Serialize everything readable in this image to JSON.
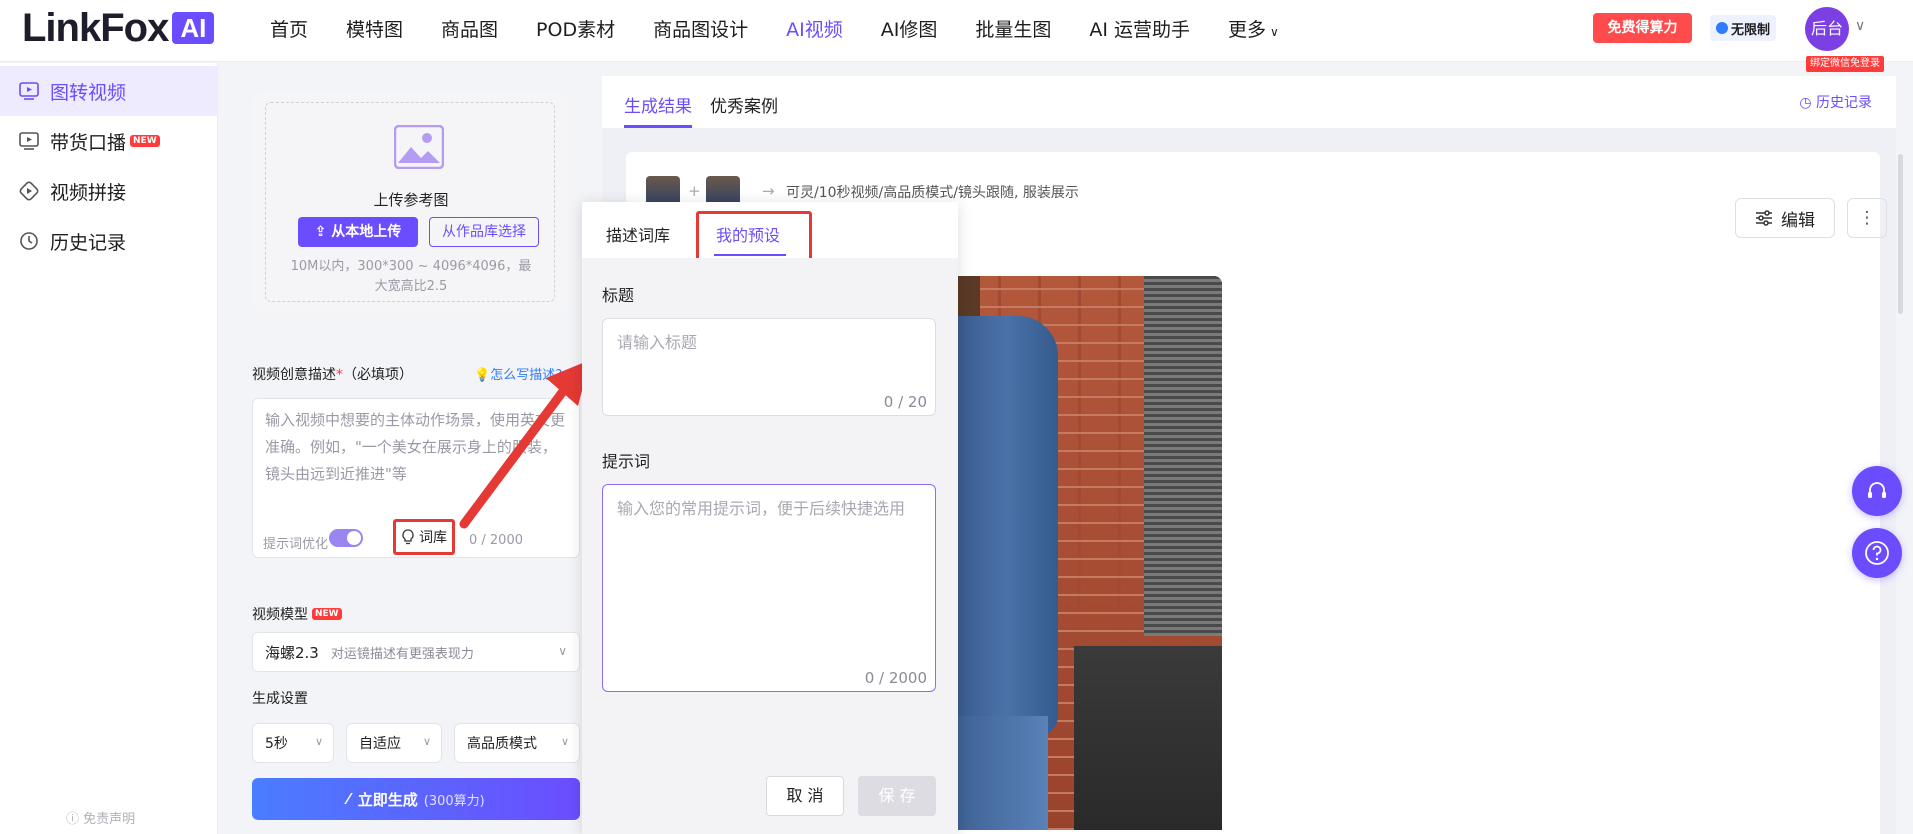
{
  "header": {
    "logo_text": "LinkFox",
    "logo_badge": "AI",
    "nav": [
      "首页",
      "模特图",
      "商品图",
      "POD素材",
      "商品图设计",
      "AI视频",
      "AI修图",
      "批量生图",
      "AI 运营助手",
      "更多"
    ],
    "active_nav": "AI视频",
    "free_button": "免费得算力",
    "unlimited_badge": "无限制",
    "avatar_text": "后台",
    "wechat_tag": "绑定微信免登录"
  },
  "sidebar": {
    "items": [
      {
        "label": "图转视频",
        "icon": "image-video-icon",
        "active": true
      },
      {
        "label": "带货口播",
        "icon": "broadcast-icon",
        "badge": "NEW"
      },
      {
        "label": "视频拼接",
        "icon": "video-merge-icon"
      },
      {
        "label": "历史记录",
        "icon": "history-icon"
      }
    ],
    "disclaimer": "免责声明"
  },
  "upload": {
    "title": "上传参考图",
    "local_button": "从本地上传",
    "library_button": "从作品库选择",
    "hint": "10M以内，300*300 ~ 4096*4096，最大宽高比2.5"
  },
  "description": {
    "label": "视频创意描述",
    "required_mark": "*",
    "required_text": "（必填项）",
    "how_link": "怎么写描述?",
    "placeholder": "输入视频中想要的主体动作场景，使用英文更准确。例如，\"一个美女在展示身上的服装，镜头由远到近推进\"等",
    "optimize_label": "提示词优化",
    "optimize_on": true,
    "library_button": "词库",
    "count": "0 / 2000"
  },
  "model": {
    "label": "视频模型",
    "badge": "NEW",
    "value": "海螺2.3",
    "desc": "对运镜描述有更强表现力"
  },
  "settings": {
    "label": "生成设置",
    "duration": "5秒",
    "ratio": "自适应",
    "quality": "高品质模式"
  },
  "generate": {
    "label": "立即生成",
    "cost": "(300算力)"
  },
  "results": {
    "tabs": [
      "生成结果",
      "优秀案例"
    ],
    "active_tab": "生成结果",
    "history_link": "历史记录",
    "meta": "可灵/10秒视频/高品质模式/镜头跟随, 服装展示",
    "edit_button": "编辑",
    "more_button": "⋮"
  },
  "popover": {
    "tabs": [
      "描述词库",
      "我的预设"
    ],
    "active_tab": "我的预设",
    "title_label": "标题",
    "title_placeholder": "请输入标题",
    "title_count": "0 / 20",
    "prompt_label": "提示词",
    "prompt_placeholder": "输入您的常用提示词，便于后续快捷选用",
    "prompt_count": "0 / 2000",
    "cancel": "取 消",
    "save": "保 存"
  },
  "colors": {
    "accent": "#6b4dff",
    "highlight_red": "#e53935",
    "free_button": "#ff4b4b"
  }
}
